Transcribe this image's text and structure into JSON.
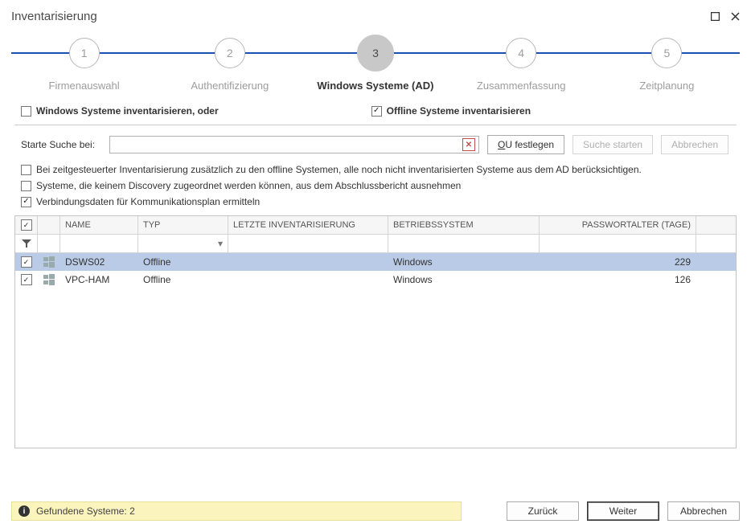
{
  "window": {
    "title": "Inventarisierung"
  },
  "stepper": {
    "steps": [
      {
        "num": "1",
        "label": "Firmenauswahl"
      },
      {
        "num": "2",
        "label": "Authentifizierung"
      },
      {
        "num": "3",
        "label": "Windows Systeme (AD)"
      },
      {
        "num": "4",
        "label": "Zusammenfassung"
      },
      {
        "num": "5",
        "label": "Zeitplanung"
      }
    ]
  },
  "topChecks": {
    "winSystems": {
      "label": "Windows Systeme inventarisieren, oder",
      "checked": false
    },
    "offline": {
      "label": "Offline Systeme inventarisieren",
      "checked": true
    }
  },
  "search": {
    "label": "Starte Suche bei:",
    "ouBtnPrefix": "O",
    "ouBtnRest": "U festlegen",
    "startBtn": "Suche starten",
    "cancelBtn": "Abbrechen"
  },
  "options": {
    "opt1": {
      "label": "Bei zeitgesteuerter Inventarisierung zusätzlich zu den offline Systemen, alle noch nicht inventarisierten Systeme aus dem AD berücksichtigen.",
      "checked": false
    },
    "opt2": {
      "label": "Systeme, die keinem Discovery zugeordnet werden können, aus dem Abschlussbericht ausnehmen",
      "checked": false
    },
    "opt3": {
      "label": "Verbindungsdaten für Kommunikationsplan ermitteln",
      "checked": true
    }
  },
  "grid": {
    "headers": {
      "name": "NAME",
      "typ": "TYP",
      "last": "LETZTE INVENTARISIERUNG",
      "os": "BETRIEBSSYSTEM",
      "pass": "PASSWORTALTER (TAGE)"
    },
    "rows": [
      {
        "checked": true,
        "name": "DSWS02",
        "typ": "Offline",
        "last": "",
        "os": "Windows",
        "pass": "229",
        "selected": true
      },
      {
        "checked": true,
        "name": "VPC-HAM",
        "typ": "Offline",
        "last": "",
        "os": "Windows",
        "pass": "126",
        "selected": false
      }
    ]
  },
  "status": {
    "text": "Gefundene Systeme:  2"
  },
  "footer": {
    "back": "Zurück",
    "next": "Weiter",
    "cancel": "Abbrechen"
  }
}
